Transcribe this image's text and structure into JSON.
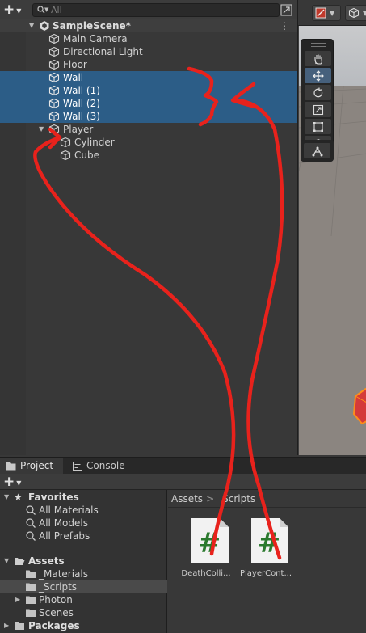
{
  "hierarchy": {
    "search": {
      "placeholder": "All"
    },
    "scene_name": "SampleScene*",
    "items": [
      {
        "label": "Main Camera"
      },
      {
        "label": "Directional Light"
      },
      {
        "label": "Floor"
      },
      {
        "label": "Wall"
      },
      {
        "label": "Wall (1)"
      },
      {
        "label": "Wall (2)"
      },
      {
        "label": "Wall (3)"
      },
      {
        "label": "Player"
      },
      {
        "label": "Cylinder"
      },
      {
        "label": "Cube"
      }
    ]
  },
  "project": {
    "tabs": [
      {
        "label": "Project"
      },
      {
        "label": "Console"
      }
    ],
    "tree": {
      "favorites": {
        "label": "Favorites",
        "items": [
          {
            "label": "All Materials"
          },
          {
            "label": "All Models"
          },
          {
            "label": "All Prefabs"
          }
        ]
      },
      "assets": {
        "label": "Assets",
        "items": [
          {
            "label": "_Materials"
          },
          {
            "label": "_Scripts"
          },
          {
            "label": "Photon"
          },
          {
            "label": "Scenes"
          }
        ]
      },
      "packages": {
        "label": "Packages"
      }
    },
    "breadcrumb": {
      "root": "Assets",
      "current": "_Scripts"
    },
    "assets": [
      {
        "label": "DeathColli...",
        "icon": "csharp-script-icon"
      },
      {
        "label": "PlayerCont...",
        "icon": "csharp-script-icon"
      }
    ]
  },
  "colors": {
    "selection": "#2c5d87",
    "annotation": "#e8221c",
    "script_hash": "#2b7a2e"
  }
}
